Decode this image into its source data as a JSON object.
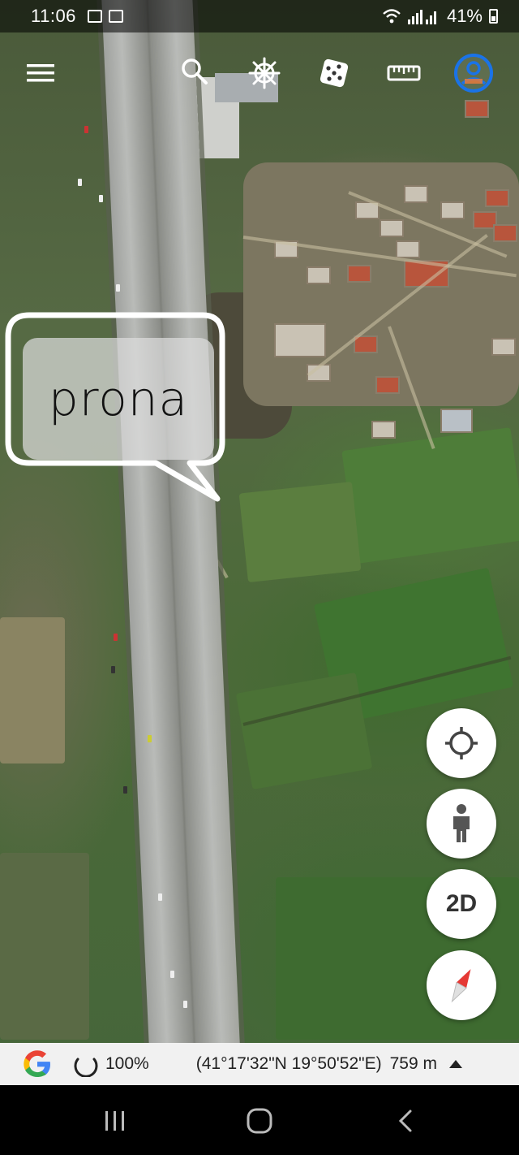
{
  "status_bar": {
    "time": "11:06",
    "notifications": [
      "image-notification-icon",
      "keyboard-notification-icon"
    ],
    "battery": "41%",
    "icons": [
      "wifi-icon",
      "signal-icon",
      "battery-icon"
    ]
  },
  "toolbar": {
    "items": [
      {
        "name": "menu-button",
        "icon": "hamburger-menu-icon"
      },
      {
        "name": "search-button",
        "icon": "search-icon"
      },
      {
        "name": "voyager-button",
        "icon": "ship-wheel-icon"
      },
      {
        "name": "feeling-lucky-button",
        "icon": "dice-icon"
      },
      {
        "name": "measure-button",
        "icon": "ruler-icon"
      },
      {
        "name": "account-button",
        "icon": "account-circle-icon"
      }
    ],
    "accent_color": "#1a73e8"
  },
  "map": {
    "type": "satellite",
    "label_text": "prona"
  },
  "map_controls": [
    {
      "name": "my-location-button",
      "icon": "target-icon"
    },
    {
      "name": "street-view-button",
      "icon": "pegman-icon"
    },
    {
      "name": "view-toggle-button",
      "label": "2D"
    },
    {
      "name": "compass-button",
      "icon": "compass-icon"
    }
  ],
  "info_bar": {
    "logo": "google-logo-icon",
    "loading_percent": "100%",
    "coordinates": "(41°17'32\"N 19°50'52\"E)",
    "altitude": "759 m",
    "expand_icon": "triangle-up-icon"
  },
  "nav_bar": {
    "buttons": [
      "recents-icon",
      "home-icon",
      "back-icon"
    ]
  }
}
